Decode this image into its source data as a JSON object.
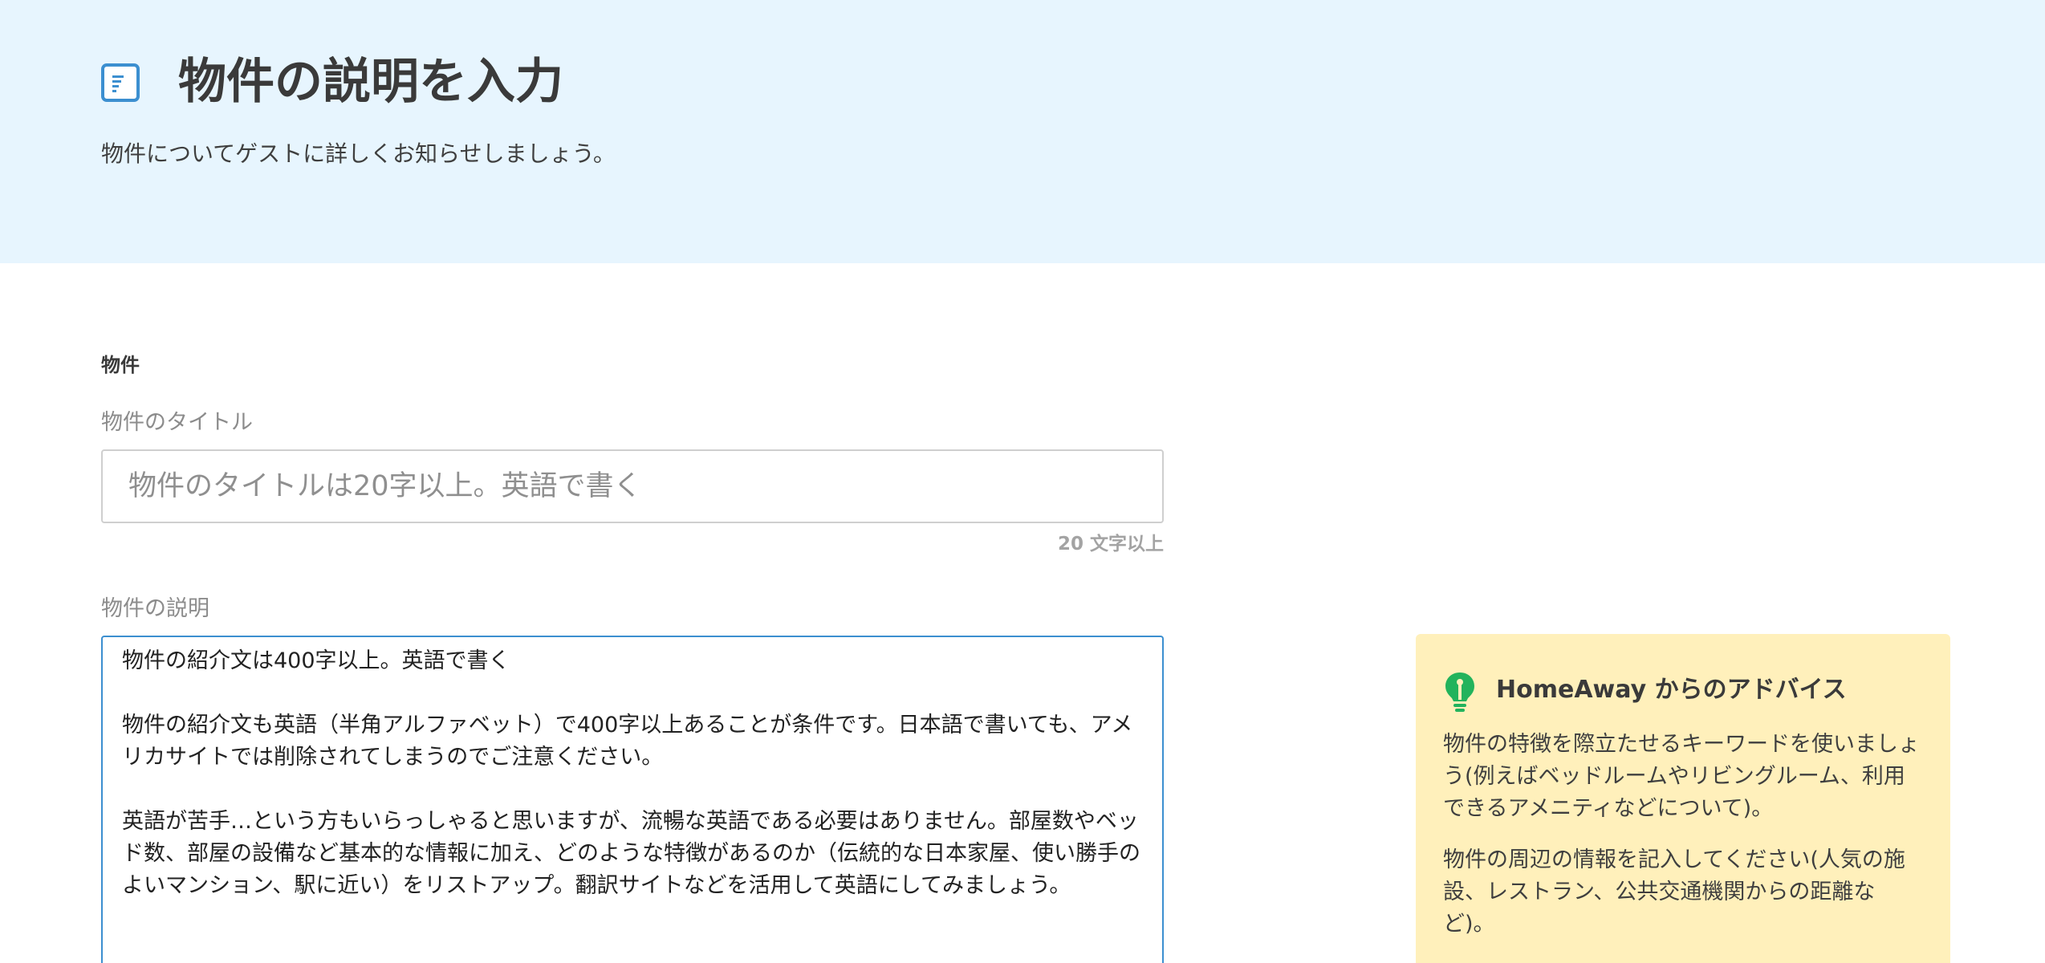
{
  "header": {
    "title": "物件の説明を入力",
    "subtitle": "物件についてゲストに詳しくお知らせしましょう。",
    "icon": "document-icon"
  },
  "form": {
    "section_label": "物件",
    "title_field": {
      "label": "物件のタイトル",
      "placeholder": "物件のタイトルは20字以上。英語で書く",
      "value": "",
      "hint": "20 文字以上"
    },
    "description_field": {
      "label": "物件の説明",
      "paragraphs": [
        "物件の紹介文は400字以上。英語で書く",
        "物件の紹介文も英語（半角アルファベット）で400字以上あることが条件です。日本語で書いても、アメリカサイトでは削除されてしまうのでご注意ください。",
        "英語が苦手…という方もいらっしゃると思いますが、流暢な英語である必要はありません。部屋数やベッド数、部屋の設備など基本的な情報に加え、どのような特徴があるのか（伝統的な日本家屋、使い勝手のよいマンション、駅に近い）をリストアップ。翻訳サイトなどを活用して英語にしてみましょう。"
      ]
    }
  },
  "advice": {
    "title": "HomeAway からのアドバイス",
    "icon": "lightbulb-icon",
    "paragraphs": [
      "物件の特徴を際立たせるキーワードを使いましょう(例えばベッドルームやリビングルーム、利用できるアメニティなどについて)。",
      "物件の周辺の情報を記入してください(人気の施設、レストラン、公共交通機関からの距離など)。"
    ]
  },
  "colors": {
    "header_bg": "#e7f5fe",
    "accent_blue": "#3c8fd0",
    "advice_bg": "#fff0bb",
    "bulb_green": "#22b35c"
  }
}
